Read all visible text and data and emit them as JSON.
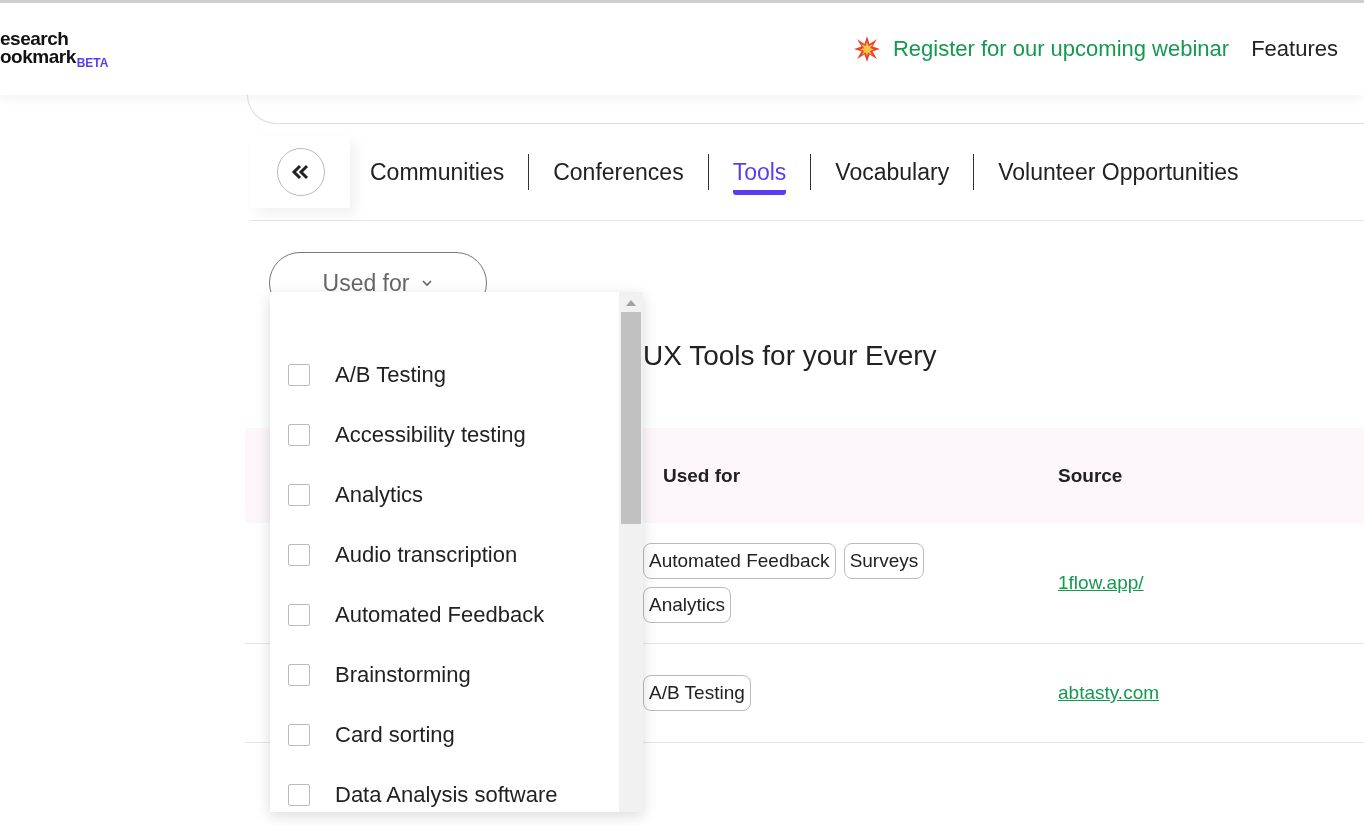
{
  "header": {
    "logo_lines": [
      "esearch",
      "ookmark"
    ],
    "badge": "BETA",
    "webinar_link": "Register for our upcoming webinar",
    "nav": [
      "Features"
    ]
  },
  "tabs": [
    {
      "label": "Communities",
      "selected": false
    },
    {
      "label": "Conferences",
      "selected": false
    },
    {
      "label": "Tools",
      "selected": true
    },
    {
      "label": "Vocabulary",
      "selected": false
    },
    {
      "label": "Volunteer Opportunities",
      "selected": false
    }
  ],
  "filter": {
    "label": "Used for"
  },
  "dropdown": {
    "options": [
      {
        "label": "A/B Testing",
        "checked": false
      },
      {
        "label": "Accessibility testing",
        "checked": false
      },
      {
        "label": "Analytics",
        "checked": false
      },
      {
        "label": "Audio transcription",
        "checked": false
      },
      {
        "label": "Automated Feedback",
        "checked": false
      },
      {
        "label": "Brainstorming",
        "checked": false
      },
      {
        "label": "Card sorting",
        "checked": false
      },
      {
        "label": "Data Analysis software",
        "checked": false
      }
    ]
  },
  "page_title": "UX Tools for your Every",
  "table": {
    "columns": [
      "Used for",
      "Source"
    ],
    "rows": [
      {
        "tags": [
          "Automated Feedback",
          "Surveys",
          "Analytics"
        ],
        "source": "1flow.app/"
      },
      {
        "tags": [
          "A/B Testing"
        ],
        "source": "abtasty.com"
      }
    ]
  }
}
